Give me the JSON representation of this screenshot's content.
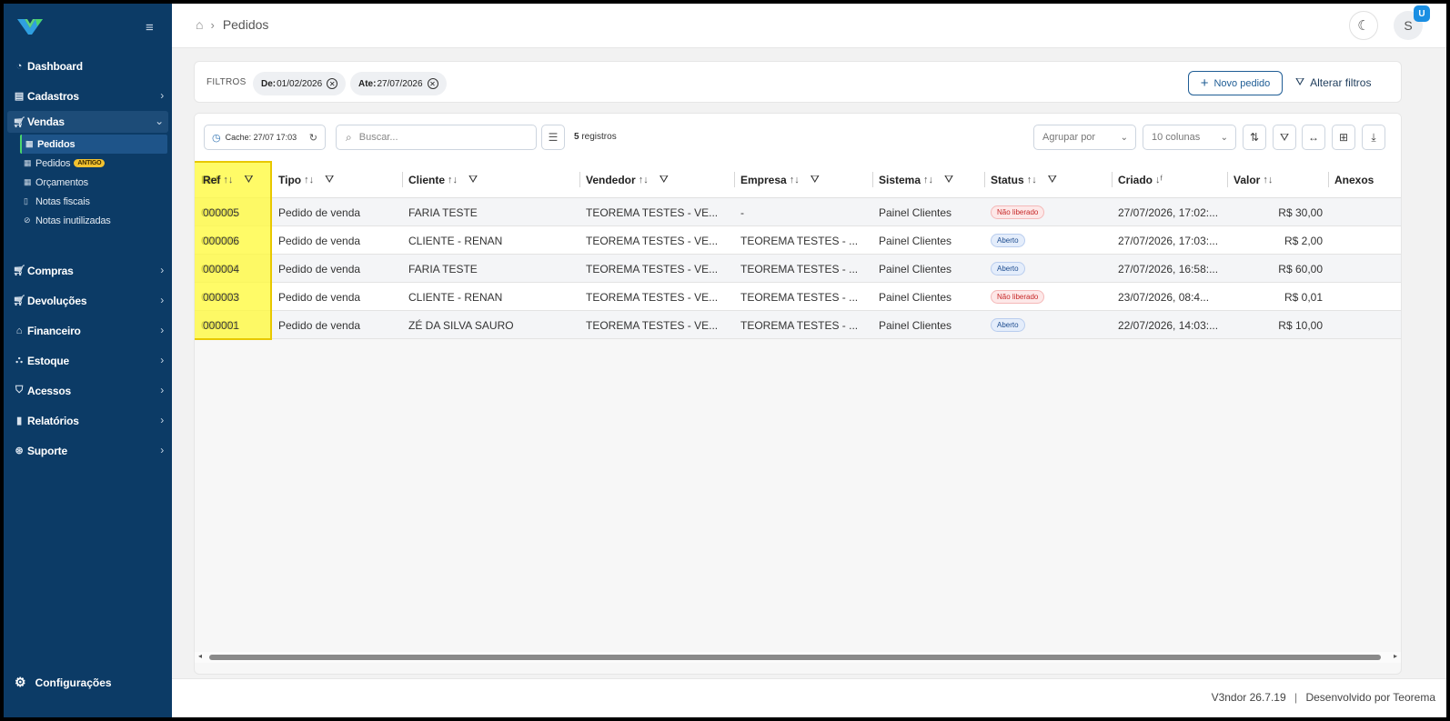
{
  "sidebar": {
    "items": [
      {
        "label": "Dashboard",
        "icon": "speedometer-icon"
      },
      {
        "label": "Cadastros",
        "icon": "id-card-icon"
      },
      {
        "label": "Vendas",
        "icon": "cart-icon"
      },
      {
        "label": "Compras",
        "icon": "cart-icon"
      },
      {
        "label": "Devoluções",
        "icon": "cart-icon"
      },
      {
        "label": "Financeiro",
        "icon": "bank-icon"
      },
      {
        "label": "Estoque",
        "icon": "boxes-icon"
      },
      {
        "label": "Acessos",
        "icon": "shield-icon"
      },
      {
        "label": "Relatórios",
        "icon": "bar-chart-icon"
      },
      {
        "label": "Suporte",
        "icon": "lifebuoy-icon"
      }
    ],
    "vendas_sub": [
      {
        "label": "Pedidos"
      },
      {
        "label": "Pedidos",
        "badge": "ANTIGO"
      },
      {
        "label": "Orçamentos"
      },
      {
        "label": "Notas fiscais"
      },
      {
        "label": "Notas inutilizadas"
      }
    ],
    "config_label": "Configurações"
  },
  "topbar": {
    "breadcrumb": "Pedidos",
    "avatar_initial": "S",
    "avatar_badge": "U"
  },
  "filters": {
    "label": "FILTROS",
    "chips": [
      {
        "key": "De:",
        "value": "01/02/2026"
      },
      {
        "key": "Ate:",
        "value": "27/07/2026"
      }
    ],
    "novo_pedido": "Novo pedido",
    "alterar_filtros": "Alterar filtros"
  },
  "toolbar": {
    "cache": "Cache: 27/07 17:03",
    "search_placeholder": "Buscar...",
    "count_number": "5",
    "count_label": "registros",
    "agrupar": "Agrupar por",
    "colunas": "10 colunas"
  },
  "table": {
    "columns": [
      "Ref",
      "Tipo",
      "Cliente",
      "Vendedor",
      "Empresa",
      "Sistema",
      "Status",
      "Criado",
      "Valor",
      "Anexos"
    ],
    "rows": [
      {
        "ref": "000005",
        "tipo": "Pedido de venda",
        "cliente": "FARIA TESTE",
        "vendedor": "TEOREMA TESTES - VE...",
        "empresa": "-",
        "sistema": "Painel Clientes",
        "status": "Não liberado",
        "status_type": "red",
        "criado": "27/07/2026, 17:02:...",
        "valor": "R$ 30,00"
      },
      {
        "ref": "000006",
        "tipo": "Pedido de venda",
        "cliente": "CLIENTE - RENAN",
        "vendedor": "TEOREMA TESTES - VE...",
        "empresa": "TEOREMA TESTES - ...",
        "sistema": "Painel Clientes",
        "status": "Aberto",
        "status_type": "blue",
        "criado": "27/07/2026, 17:03:...",
        "valor": "R$ 2,00"
      },
      {
        "ref": "000004",
        "tipo": "Pedido de venda",
        "cliente": "FARIA TESTE",
        "vendedor": "TEOREMA TESTES - VE...",
        "empresa": "TEOREMA TESTES - ...",
        "sistema": "Painel Clientes",
        "status": "Aberto",
        "status_type": "blue",
        "criado": "27/07/2026, 16:58:...",
        "valor": "R$ 60,00"
      },
      {
        "ref": "000003",
        "tipo": "Pedido de venda",
        "cliente": "CLIENTE - RENAN",
        "vendedor": "TEOREMA TESTES - VE...",
        "empresa": "TEOREMA TESTES - ...",
        "sistema": "Painel Clientes",
        "status": "Não liberado",
        "status_type": "red",
        "criado": "23/07/2026, 08:4...",
        "valor": "R$ 0,01"
      },
      {
        "ref": "000001",
        "tipo": "Pedido de venda",
        "cliente": "ZÉ DA SILVA SAURO",
        "vendedor": "TEOREMA TESTES - VE...",
        "empresa": "TEOREMA TESTES - ...",
        "sistema": "Painel Clientes",
        "status": "Aberto",
        "status_type": "blue",
        "criado": "22/07/2026, 14:03:...",
        "valor": "R$ 10,00"
      }
    ]
  },
  "footer": {
    "version": "V3ndor 26.7.19",
    "separator": "|",
    "credits": "Desenvolvido por Teorema"
  },
  "colors": {
    "sidebar": "#0c3b66",
    "accent": "#1f5d95",
    "highlight": "#fff93c"
  }
}
